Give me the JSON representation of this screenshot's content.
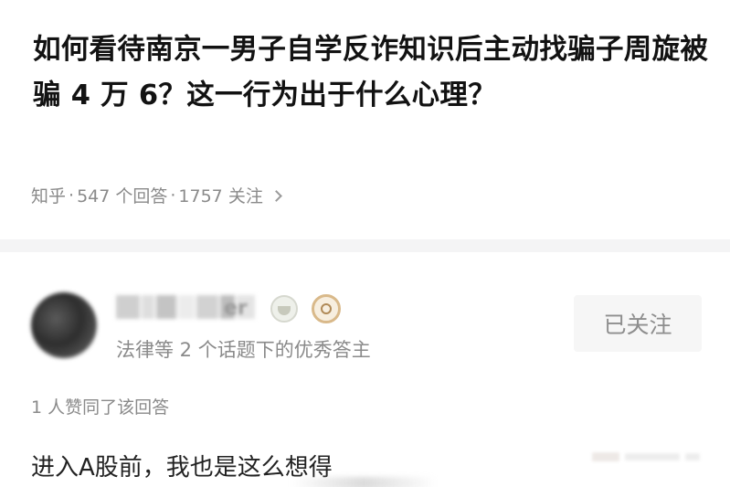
{
  "question": {
    "title": "如何看待南京一男子自学反诈知识后主动找骗子周旋被骗 4 万 6？这一行为出于什么心理？",
    "source": "知乎",
    "separator": "·",
    "answers_count": "547 个回答",
    "followers_count": "1757 关注"
  },
  "author": {
    "name_visible_fragment": "er",
    "headline": "法律等 2 个话题下的优秀答主",
    "follow_button_label": "已关注",
    "name_blur_colors": [
      "#cfcfcf",
      "#dedede",
      "#c4c4c4",
      "#ececec",
      "#d2d2d2",
      "#bdbdbd",
      "#e4e4e4"
    ],
    "badges": [
      "achievement-cup-icon",
      "excellent-answerer-medal-icon"
    ]
  },
  "answer": {
    "vote_text": "1 人赞同了该回答",
    "excerpt": "进入A股前，我也是这么想得"
  }
}
